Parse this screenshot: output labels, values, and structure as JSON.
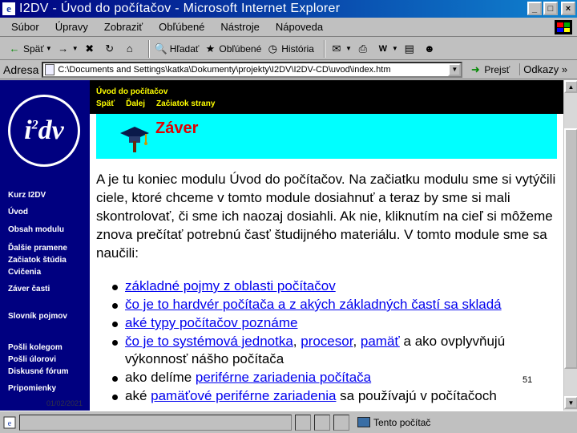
{
  "window": {
    "title": "I2DV - Úvod do počítačov - Microsoft Internet Explorer",
    "app_icon_letter": "e",
    "buttons": [
      "_",
      "□",
      "×"
    ]
  },
  "menu": [
    "Súbor",
    "Úpravy",
    "Zobraziť",
    "Obľúbené",
    "Nástroje",
    "Nápoveda"
  ],
  "toolbar": {
    "back": "Späť",
    "forward_icon": "→",
    "stop_icon": "✖",
    "refresh_icon": "↻",
    "home_icon": "⌂",
    "search": "Hľadať",
    "favorites": "Obľúbené",
    "history": "História"
  },
  "address": {
    "label": "Adresa",
    "url": "C:\\Documents and Settings\\katka\\Dokumenty\\projekty\\I2DV\\I2DV-CD\\uvod\\index.htm",
    "go": "Prejsť",
    "links": "Odkazy »"
  },
  "leftnav": {
    "logo_text": "i",
    "logo_sup": "2",
    "logo_rest": "dv",
    "links": [
      "Kurz I2DV",
      "Úvod",
      "Obsah modulu",
      "Ďalšie pramene",
      "Začiatok štúdia",
      "Cvičenia",
      "Záver časti",
      "Slovník pojmov",
      "Pošli kolegom",
      "Pošli úlorovi",
      "Diskusné fórum",
      "Pripomienky"
    ],
    "date_text": "01/02/2021"
  },
  "page": {
    "header_title": "Úvod do počítačov",
    "header_links": [
      "Späť",
      "Ďalej",
      "Začiatok strany"
    ],
    "heading": "Záver",
    "paragraph": "A je tu koniec modulu Úvod do počítačov. Na začiatku modulu sme si vytýčili ciele, ktoré chceme v tomto module dosiahnuť a teraz by sme si mali skontrolovať, či sme ich naozaj dosiahli. Ak nie, kliknutím na cieľ si môžeme znova prečítať potrebnú časť študijného materiálu. V tomto module sme sa naučili:",
    "bullets": [
      {
        "link": "základné pojmy z oblasti počítačov",
        "rest": ""
      },
      {
        "link": "čo je to hardvér počítača a z akých základných častí sa skladá",
        "rest": ""
      },
      {
        "link": "aké typy počítačov poznáme",
        "rest": ""
      },
      {
        "link": "čo je to systémová jednotka",
        "rest": ", ",
        "link2": "procesor",
        "rest2": ", ",
        "link3": "pamäť",
        "rest3": " a ako ovplyvňujú výkonnosť nášho počítača"
      },
      {
        "prefix": "ako delíme ",
        "link": "periférne zariadenia počítača",
        "rest": ""
      },
      {
        "prefix": "aké ",
        "link": "pamäťové periférne zariadenia",
        "rest": " sa používajú v počítačoch"
      }
    ],
    "page_number": "51"
  },
  "status": {
    "zone": "Tento počítač"
  },
  "colors": {
    "nav_bg": "#000080",
    "band": "#00ffff",
    "heading": "#e00000",
    "header_text": "#ffff00",
    "link": "#0000ee"
  }
}
